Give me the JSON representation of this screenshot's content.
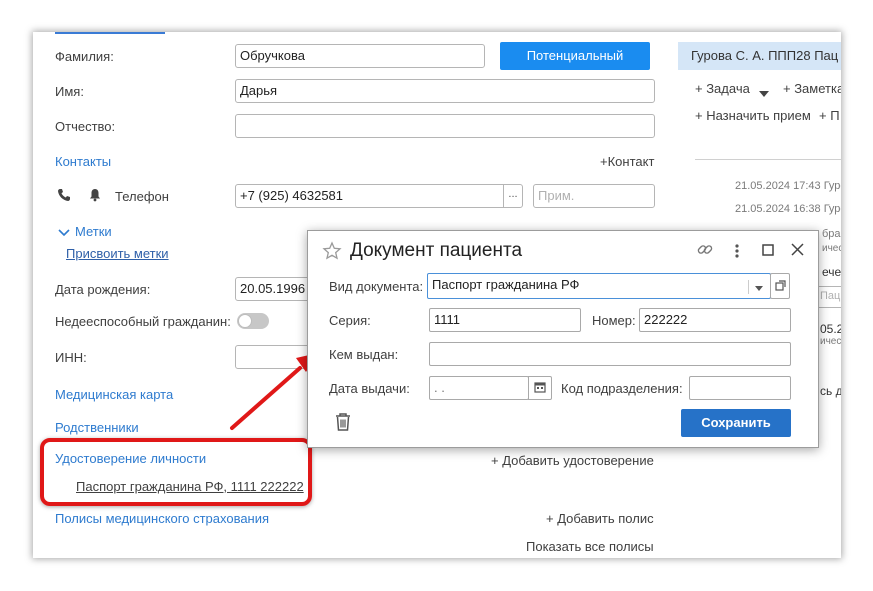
{
  "form": {
    "surname_label": "Фамилия:",
    "surname_value": "Обручкова",
    "name_label": "Имя:",
    "name_value": "Дарья",
    "patronymic_label": "Отчество:",
    "patronymic_value": "",
    "status_button": "Потенциальный",
    "contacts_label": "Контакты",
    "add_contact": "+Контакт",
    "phone_label": "Телефон",
    "phone_value": "+7 (925) 4632581",
    "phone_ellipsis": "...",
    "phone_note_placeholder": "Прим.",
    "tags_label": "Метки",
    "assign_tags": "Присвоить метки",
    "birthdate_label": "Дата рождения:",
    "birthdate_value": "20.05.1996",
    "incapacitated_label": "Недееспособный гражданин:",
    "inn_label": "ИНН:",
    "inn_value": "",
    "medical_card": "Медицинская карта",
    "relatives": "Родственники",
    "identity_label": "Удостоверение личности",
    "add_identity": "+ Добавить удостоверение",
    "identity_item": "Паспорт гражданина РФ, 1111 222222",
    "insurance_label": "Полисы медицинского страхования",
    "add_policy": "+ Добавить полис",
    "show_policies": "Показать все полисы"
  },
  "right_panel": {
    "banner": "Гурова С. А. ППП28  Пац",
    "task": "+ Задача",
    "note": "+ Заметка",
    "appointment": "+ Назначить прием",
    "appointment_more": "+ П",
    "log": [
      {
        "time": "21.05.2024 17:43 Гуро"
      },
      {
        "time": "21.05.2024 16:38 Гуро"
      }
    ],
    "fragments": [
      "бра",
      "ичес",
      "ечен",
      "Пац",
      "05.2",
      "ичес",
      "сь д"
    ]
  },
  "dialog": {
    "title": "Документ пациента",
    "doc_type_label": "Вид документа:",
    "doc_type_value": "Паспорт гражданина РФ",
    "series_label": "Серия:",
    "series_value": "1111",
    "number_label": "Номер:",
    "number_value": "222222",
    "issued_by_label": "Кем выдан:",
    "issued_by_value": "",
    "issue_date_label": "Дата выдачи:",
    "issue_date_value": " .  .",
    "division_code_label": "Код подразделения:",
    "division_code_value": "",
    "save": "Сохранить"
  },
  "colors": {
    "accent": "#1a8cf0",
    "link": "#2e7bcf",
    "save_button": "#2672c8",
    "highlight": "#e01818",
    "banner": "#d5e6f7"
  }
}
